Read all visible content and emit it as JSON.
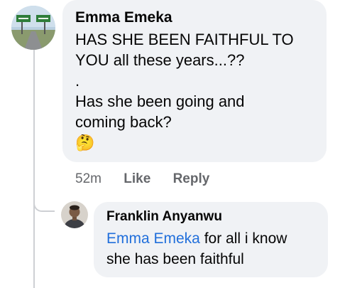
{
  "comment": {
    "author": "Emma Emeka",
    "lines": [
      "HAS SHE BEEN FAITHFUL TO",
      "YOU all these years...??",
      ".",
      "Has she been going and",
      "coming back?"
    ],
    "emoji": "🤔",
    "emoji_icon": "thinking-face-emoji",
    "actions": {
      "time": "52m",
      "like": "Like",
      "reply": "Reply"
    }
  },
  "reply": {
    "author": "Franklin Anyanwu",
    "mention": "Emma Emeka",
    "line1_rest": " for all i know",
    "line2": "she has been faithful"
  },
  "colors": {
    "bubble_bg": "#f0f2f5",
    "mention": "#216fdb",
    "meta_text": "#65676b",
    "thread_line": "#ced0d4"
  }
}
